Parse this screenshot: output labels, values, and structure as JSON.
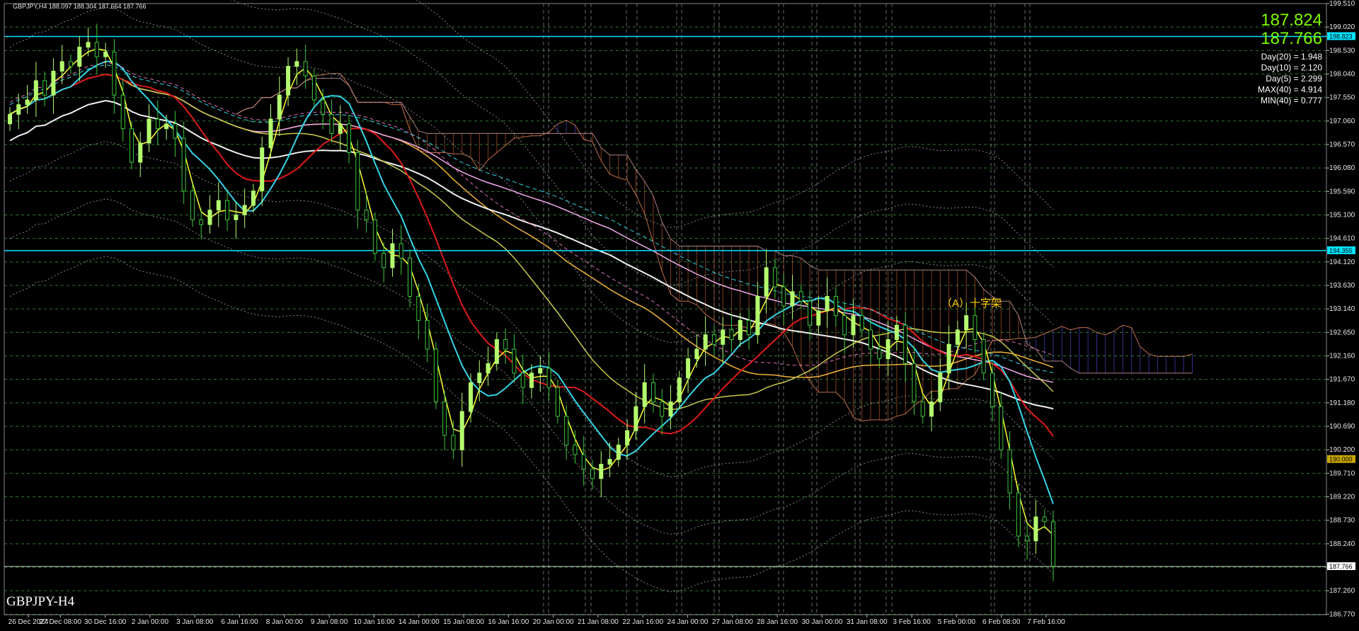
{
  "window": {
    "header": "GBPJPY,H4  188.097 188.304 187.664 187.766",
    "symbol_label": "GBPJPY-H4"
  },
  "info_panel": {
    "bid": "187.824",
    "ask": "187.766",
    "stats": [
      "Day(20) = 1.948",
      "Day(10) = 2.120",
      "Day(5) = 2.299",
      "MAX(40) = 4.914",
      "MIN(40) = 0.777"
    ]
  },
  "annotation": {
    "text": "（A）十字架"
  },
  "colors": {
    "background": "#000000",
    "bull_candle": "#b4ff6e",
    "bear_candle": "#3cc83c",
    "hline": "#00e5ff",
    "ma_yellow": "#ffff33",
    "ma_cyan": "#35d4e6",
    "ma_red": "#e01a1a",
    "ma_khaki": "#c9c94a",
    "ma_orange": "#f2b33a",
    "ma_pink": "#f0a8e8",
    "ma_white": "#f0f0f0",
    "cloud_bull": "#5a5aff",
    "cloud_bear": "#e4713a"
  },
  "chart_data": {
    "type": "candlestick",
    "symbol": "GBPJPY",
    "timeframe": "H4",
    "ylim": [
      186.76,
      199.51
    ],
    "y_ticks": [
      "199.510",
      "199.020",
      "198.530",
      "198.040",
      "197.550",
      "197.060",
      "196.570",
      "196.080",
      "195.590",
      "195.100",
      "194.610",
      "194.120",
      "193.630",
      "193.140",
      "192.650",
      "192.160",
      "191.670",
      "191.180",
      "190.690",
      "190.200",
      "189.710",
      "189.220",
      "188.730",
      "188.240",
      "187.750",
      "187.260",
      "186.770"
    ],
    "x_tick_labels": [
      "26 Dec 2024",
      "27 Dec 08:00",
      "30 Dec 16:00",
      "2 Jan 00:00",
      "3 Jan 08:00",
      "6 Jan 16:00",
      "8 Jan 00:00",
      "9 Jan 08:00",
      "10 Jan 16:00",
      "14 Jan 00:00",
      "15 Jan 08:00",
      "16 Jan 16:00",
      "20 Jan 00:00",
      "21 Jan 08:00",
      "22 Jan 16:00",
      "24 Jan 00:00",
      "27 Jan 08:00",
      "28 Jan 16:00",
      "30 Jan 00:00",
      "31 Jan 08:00",
      "3 Feb 16:00",
      "5 Feb 00:00",
      "6 Feb 08:00",
      "7 Feb 16:00"
    ],
    "price_labels": [
      {
        "text": "198.823",
        "value": 198.823,
        "color": "#00e5ff"
      },
      {
        "text": "194.355",
        "value": 194.355,
        "color": "#00e5ff"
      },
      {
        "text": "190.000",
        "value": 190.0,
        "color": "#c8a800"
      },
      {
        "text": "187.766",
        "value": 187.766,
        "color": "#ffffff"
      }
    ],
    "horizontal_lines": [
      198.823,
      194.355
    ],
    "closes": [
      197.2,
      197.4,
      197.5,
      197.9,
      197.6,
      198.1,
      198.3,
      198.2,
      198.6,
      198.7,
      198.4,
      198.5,
      197.6,
      196.9,
      196.2,
      196.6,
      197.1,
      196.9,
      197.0,
      196.7,
      195.6,
      195.0,
      194.9,
      195.2,
      195.4,
      195.0,
      195.1,
      195.3,
      195.6,
      196.5,
      197.1,
      197.6,
      198.2,
      198.3,
      198.0,
      197.5,
      197.2,
      196.8,
      197.0,
      196.4,
      195.2,
      195.0,
      194.3,
      194.0,
      194.5,
      194.2,
      193.4,
      192.9,
      192.3,
      191.2,
      190.5,
      190.2,
      191.0,
      191.6,
      191.8,
      192.0,
      192.5,
      192.3,
      191.8,
      191.5,
      191.8,
      191.9,
      191.5,
      190.9,
      190.3,
      190.1,
      189.8,
      189.6,
      189.9,
      190.0,
      190.3,
      190.6,
      191.1,
      191.6,
      191.2,
      190.9,
      191.2,
      191.7,
      192.1,
      192.3,
      192.6,
      192.4,
      192.7,
      192.5,
      192.9,
      192.6,
      193.4,
      194.0,
      193.6,
      193.2,
      193.5,
      193.3,
      192.8,
      193.1,
      193.4,
      193.0,
      192.6,
      193.0,
      192.7,
      192.3,
      192.1,
      192.5,
      192.8,
      192.0,
      191.2,
      190.9,
      191.2,
      191.8,
      192.4,
      192.7,
      193.0,
      192.5,
      191.8,
      191.1,
      190.2,
      189.3,
      188.4,
      188.3,
      188.8,
      188.7,
      187.77
    ],
    "legend": []
  }
}
